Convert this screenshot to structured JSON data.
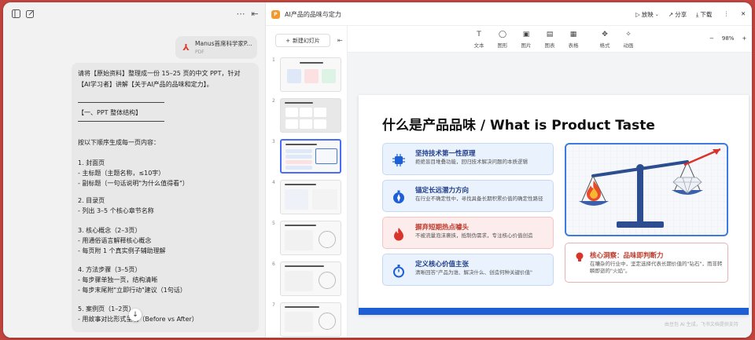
{
  "left": {
    "attachment": {
      "name": "Manus首席科学家P...",
      "type": "PDF"
    },
    "message": [
      "请将【原始资料】整理成一份 15–25 页的中文 PPT，针对",
      "【AI学习者】讲解【关于AI产品的品味和定力】。",
      "【一、PPT 整体结构】",
      "按以下顺序生成每一页内容：",
      "1. 封面页",
      "  - 主标题（主题名称，≤10字）",
      "  - 副标题（一句话说明\"为什么值得看\"）",
      "2. 目录页",
      "  - 列出 3–5 个核心章节名称",
      "3. 核心概念（2–3页）",
      "  - 用通俗语言解释核心概念",
      "  - 每页附 1 个真实例子辅助理解",
      "4. 方法步骤（3–5页）",
      "  - 每步骤单独一页，结构清晰",
      "  - 每步末尾附\"立即行动\"建议（1句话）",
      "5. 案例页（1–2页）",
      "  - 用故事对比形式呈现（Before vs After）"
    ]
  },
  "right": {
    "doc_title": "AI产品的品味与定力",
    "toolbar": {
      "play": "放映",
      "share": "分享",
      "download": "下载"
    },
    "new_slide": "新建幻灯片",
    "thumb_numbers": [
      "1",
      "2",
      "3",
      "4",
      "5",
      "6",
      "7"
    ],
    "tools": [
      {
        "label": "文本",
        "glyph": "T"
      },
      {
        "label": "图形",
        "glyph": "◯"
      },
      {
        "label": "图片",
        "glyph": "▣"
      },
      {
        "label": "图表",
        "glyph": "▤"
      },
      {
        "label": "表格",
        "glyph": "▦"
      },
      {
        "label": "格式",
        "glyph": "✥"
      },
      {
        "label": "动画",
        "glyph": "✧"
      }
    ],
    "zoom": {
      "minus": "−",
      "value": "98%",
      "plus": "+"
    },
    "slide": {
      "title": "什么是产品品味 / What is Product Taste",
      "cards": [
        {
          "title": "坚持技术第一性原理",
          "desc": "拒绝盲目堆叠功能，回归技术解决问题的本质逻辑"
        },
        {
          "title": "锚定长远潜力方向",
          "desc": "在行业不确定性中，寻找具备长期积累价值的确定性路径"
        },
        {
          "title": "摒弃短期热点噱头",
          "desc": "不被流量泡沫裹挟，抵制伪需求，专注核心价值创造"
        },
        {
          "title": "定义核心价值主张",
          "desc": "清晰回答\"产品为谁、解决什么、创造何种关键价值\""
        }
      ],
      "insight": {
        "title": "核心洞察：品味即判断力",
        "desc": "在嘈杂的行业中，坚定选择代表长期价值的\"钻石\"，而非转瞬即逝的\"火焰\"。"
      }
    },
    "footnote": "由豆包 AI 生成，飞书文档提供支持"
  },
  "colors": {
    "accent": "#1f5fd6",
    "card_blue": "#eaf2fd",
    "card_red": "#fdecec",
    "frame": "#c2453f"
  }
}
